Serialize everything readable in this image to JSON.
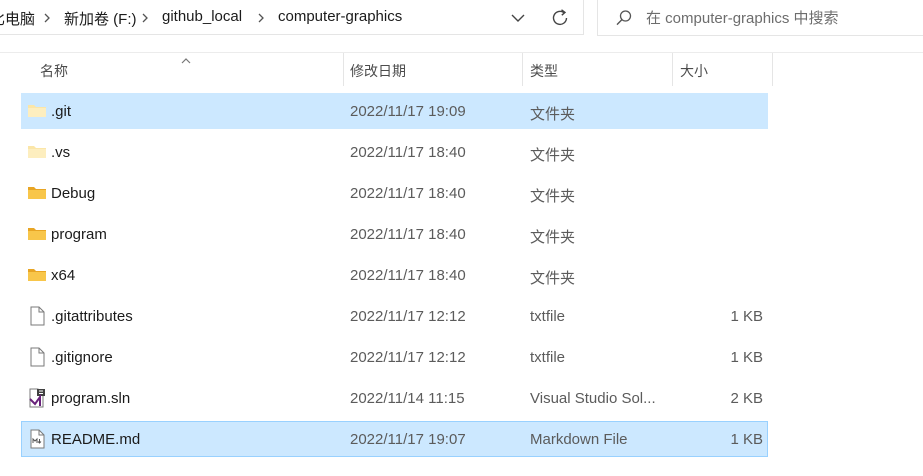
{
  "breadcrumb": {
    "items": [
      "比电脑",
      "新加卷 (F:)",
      "github_local",
      "computer-graphics"
    ]
  },
  "search": {
    "placeholder": "在 computer-graphics 中搜索"
  },
  "columns": {
    "name": "名称",
    "modified": "修改日期",
    "type": "类型",
    "size": "大小"
  },
  "files": [
    {
      "name": ".git",
      "date": "2022/11/17 19:09",
      "type": "文件夹",
      "size": "",
      "icon": "folder-faded-icon"
    },
    {
      "name": ".vs",
      "date": "2022/11/17 18:40",
      "type": "文件夹",
      "size": "",
      "icon": "folder-faded-icon"
    },
    {
      "name": "Debug",
      "date": "2022/11/17 18:40",
      "type": "文件夹",
      "size": "",
      "icon": "folder-icon"
    },
    {
      "name": "program",
      "date": "2022/11/17 18:40",
      "type": "文件夹",
      "size": "",
      "icon": "folder-icon"
    },
    {
      "name": "x64",
      "date": "2022/11/17 18:40",
      "type": "文件夹",
      "size": "",
      "icon": "folder-icon"
    },
    {
      "name": ".gitattributes",
      "date": "2022/11/17 12:12",
      "type": "txtfile",
      "size": "1 KB",
      "icon": "file-icon"
    },
    {
      "name": ".gitignore",
      "date": "2022/11/17 12:12",
      "type": "txtfile",
      "size": "1 KB",
      "icon": "file-icon"
    },
    {
      "name": "program.sln",
      "date": "2022/11/14 11:15",
      "type": "Visual Studio Sol...",
      "size": "2 KB",
      "icon": "visual-studio-solution-icon"
    },
    {
      "name": "README.md",
      "date": "2022/11/17 19:07",
      "type": "Markdown File",
      "size": "1 KB",
      "icon": "markdown-file-icon"
    }
  ],
  "colors": {
    "selection": "#cce8ff",
    "selection_border": "#99d1ff",
    "folder": "#f8c64a"
  }
}
